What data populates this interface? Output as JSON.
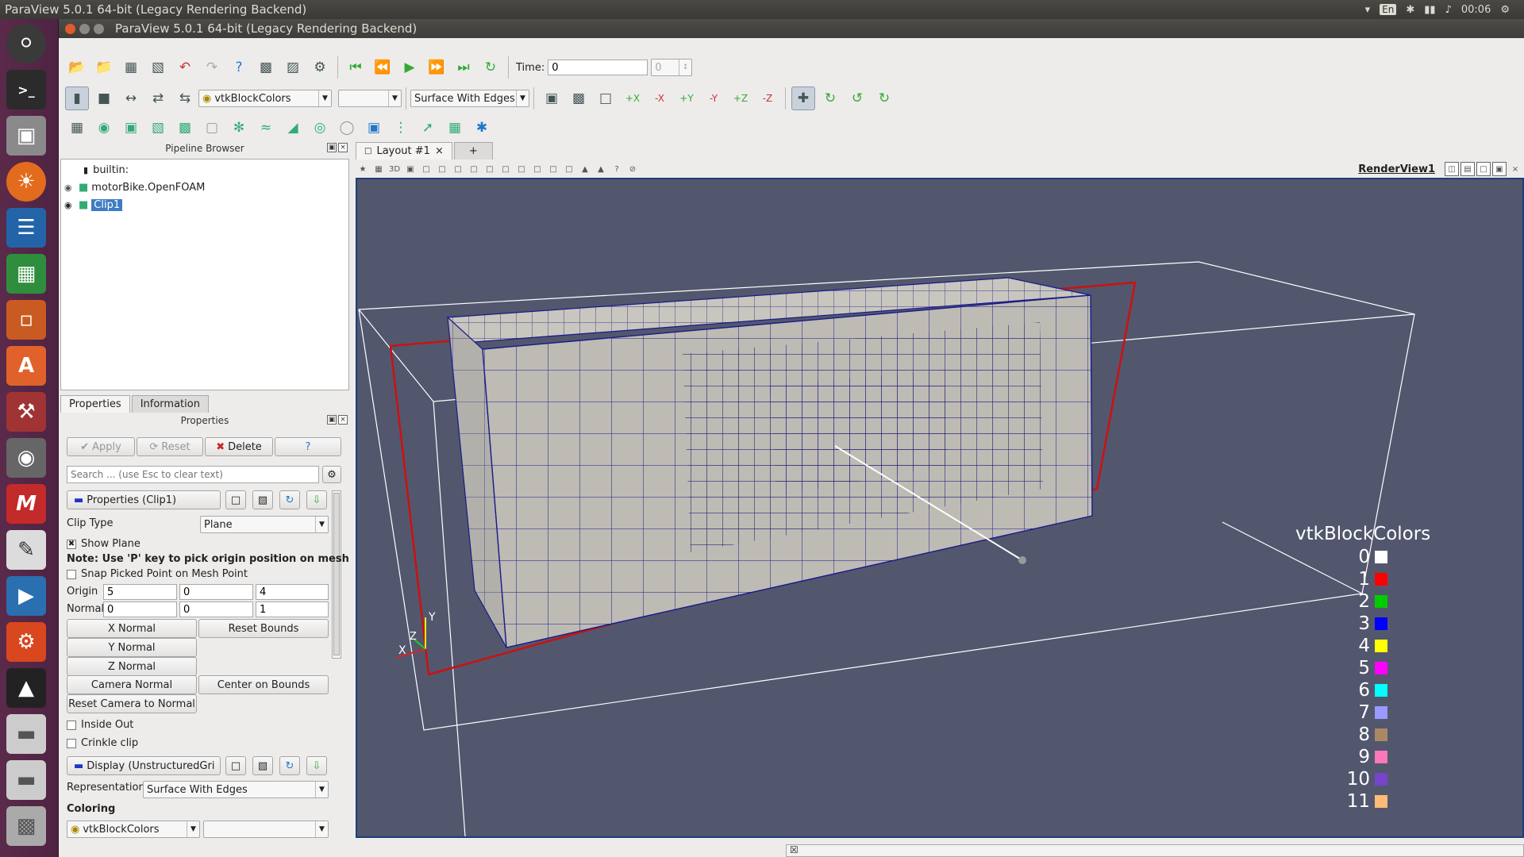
{
  "os": {
    "title": "ParaView 5.0.1 64-bit (Legacy Rendering Backend)",
    "keyboard": "En",
    "clock": "00:06"
  },
  "window": {
    "title": "ParaView 5.0.1 64-bit (Legacy Rendering Backend)"
  },
  "toolbar": {
    "time_label": "Time:",
    "time_value": "0",
    "time_index": "0",
    "color_array": "vtkBlockColors",
    "color_component": "",
    "representation": "Surface With Edges"
  },
  "pipeline": {
    "header": "Pipeline Browser",
    "items": [
      {
        "label": "builtin:"
      },
      {
        "label": "motorBike.OpenFOAM"
      },
      {
        "label": "Clip1"
      }
    ]
  },
  "props": {
    "tab_properties": "Properties",
    "tab_information": "Information",
    "header": "Properties",
    "apply": "Apply",
    "reset": "Reset",
    "delete": "Delete",
    "help": "?",
    "search_placeholder": "Search ... (use Esc to clear text)",
    "section_clip": "Properties (Clip1)",
    "clip_type_label": "Clip Type",
    "clip_type_value": "Plane",
    "show_plane": "Show Plane",
    "note": "Note: Use 'P' key to pick origin position on mesh",
    "snap": "Snap Picked Point on Mesh Point",
    "origin_label": "Origin",
    "origin": [
      "5",
      "0",
      "4"
    ],
    "normal_label": "Normal",
    "normal": [
      "0",
      "0",
      "1"
    ],
    "x_normal": "X Normal",
    "y_normal": "Y Normal",
    "z_normal": "Z Normal",
    "reset_bounds": "Reset Bounds",
    "camera_normal": "Camera Normal",
    "center_on_bounds": "Center on Bounds",
    "reset_camera_normal": "Reset Camera to Normal",
    "inside_out": "Inside Out",
    "crinkle": "Crinkle clip",
    "section_display": "Display (UnstructuredGri",
    "representation_label": "Representation",
    "representation_value": "Surface With Edges",
    "coloring_label": "Coloring",
    "coloring_value": "vtkBlockColors",
    "coloring_component": ""
  },
  "layout": {
    "tab": "Layout #1",
    "add_tab": "+",
    "view_name": "RenderView1"
  },
  "legend": {
    "title": "vtkBlockColors",
    "entries": [
      {
        "label": "0",
        "color": "#ffffff"
      },
      {
        "label": "1",
        "color": "#ff0000"
      },
      {
        "label": "2",
        "color": "#00cc00"
      },
      {
        "label": "3",
        "color": "#0000ff"
      },
      {
        "label": "4",
        "color": "#ffff00"
      },
      {
        "label": "5",
        "color": "#ff00ff"
      },
      {
        "label": "6",
        "color": "#00ffff"
      },
      {
        "label": "7",
        "color": "#9999ff"
      },
      {
        "label": "8",
        "color": "#aa8866"
      },
      {
        "label": "9",
        "color": "#ff77bb"
      },
      {
        "label": "10",
        "color": "#7744cc"
      },
      {
        "label": "11",
        "color": "#ffbb77"
      }
    ]
  },
  "axes": {
    "x": "X",
    "y": "Y",
    "z": "Z"
  }
}
